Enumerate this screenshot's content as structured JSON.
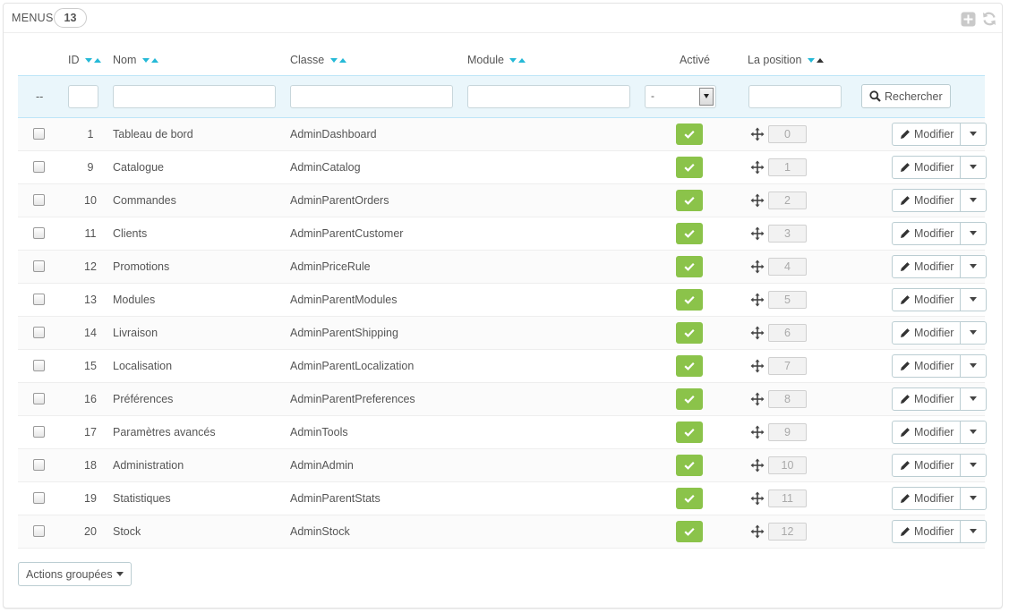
{
  "header": {
    "title": "Menus",
    "count": "13",
    "add_icon": "plus-square-icon",
    "refresh_icon": "refresh-icon"
  },
  "columns": {
    "id": "ID",
    "name": "Nom",
    "class": "Classe",
    "module": "Module",
    "active": "Activé",
    "position": "La position"
  },
  "filters": {
    "bulk_placeholder": "--",
    "id": "",
    "name": "",
    "class": "",
    "module": "",
    "active_selected": "-",
    "position": "",
    "search_label": "Rechercher"
  },
  "rows": [
    {
      "id": "1",
      "name": "Tableau de bord",
      "class": "AdminDashboard",
      "module": "",
      "active": true,
      "position": "0"
    },
    {
      "id": "9",
      "name": "Catalogue",
      "class": "AdminCatalog",
      "module": "",
      "active": true,
      "position": "1"
    },
    {
      "id": "10",
      "name": "Commandes",
      "class": "AdminParentOrders",
      "module": "",
      "active": true,
      "position": "2"
    },
    {
      "id": "11",
      "name": "Clients",
      "class": "AdminParentCustomer",
      "module": "",
      "active": true,
      "position": "3"
    },
    {
      "id": "12",
      "name": "Promotions",
      "class": "AdminPriceRule",
      "module": "",
      "active": true,
      "position": "4"
    },
    {
      "id": "13",
      "name": "Modules",
      "class": "AdminParentModules",
      "module": "",
      "active": true,
      "position": "5"
    },
    {
      "id": "14",
      "name": "Livraison",
      "class": "AdminParentShipping",
      "module": "",
      "active": true,
      "position": "6"
    },
    {
      "id": "15",
      "name": "Localisation",
      "class": "AdminParentLocalization",
      "module": "",
      "active": true,
      "position": "7"
    },
    {
      "id": "16",
      "name": "Préférences",
      "class": "AdminParentPreferences",
      "module": "",
      "active": true,
      "position": "8"
    },
    {
      "id": "17",
      "name": "Paramètres avancés",
      "class": "AdminTools",
      "module": "",
      "active": true,
      "position": "9"
    },
    {
      "id": "18",
      "name": "Administration",
      "class": "AdminAdmin",
      "module": "",
      "active": true,
      "position": "10"
    },
    {
      "id": "19",
      "name": "Statistiques",
      "class": "AdminParentStats",
      "module": "",
      "active": true,
      "position": "11"
    },
    {
      "id": "20",
      "name": "Stock",
      "class": "AdminStock",
      "module": "",
      "active": true,
      "position": "12"
    }
  ],
  "row_action_label": "Modifier",
  "bulk_actions_label": "Actions groupées",
  "colors": {
    "accent": "#25b9d7",
    "active_green": "#8bc34a",
    "filter_bg": "#eaf6fb"
  }
}
